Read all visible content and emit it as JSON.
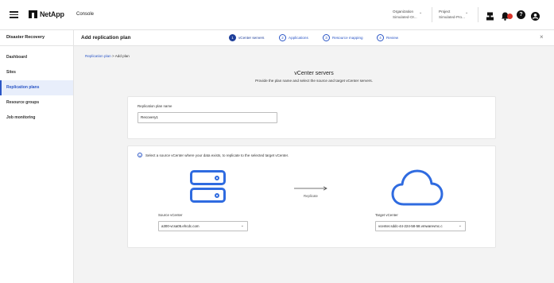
{
  "header": {
    "brand": "NetApp",
    "section": "Console",
    "organization": {
      "label": "Organization",
      "value": "Simulated-Or..."
    },
    "project": {
      "label": "Project",
      "value": "Simulated-Pro..."
    },
    "help_icon": "question-circle-icon",
    "user_icon": "user-circle-icon",
    "notifications_icon": "bell-icon",
    "connector_icon": "connector-icon",
    "badge_color": "#d9342b"
  },
  "subheader": {
    "service": "Disaster Recovery",
    "page_title": "Add replication plan",
    "steps": [
      {
        "num": "1",
        "label": "vCenter servers"
      },
      {
        "num": "2",
        "label": "Applications"
      },
      {
        "num": "3",
        "label": "Resource mapping"
      },
      {
        "num": "4",
        "label": "Review"
      }
    ],
    "active_step": 1,
    "close_label": "×"
  },
  "sidebar": {
    "items": [
      {
        "label": "Dashboard"
      },
      {
        "label": "Sites"
      },
      {
        "label": "Replication plans"
      },
      {
        "label": "Resource groups"
      },
      {
        "label": "Job monitoring"
      }
    ],
    "active_index": 2
  },
  "breadcrumb": {
    "link": "Replication plan",
    "separator": ">",
    "current": "Add plan"
  },
  "main": {
    "heading": "vCenter servers",
    "subheading": "Provide the plan name and select the source and target vCenter servers.",
    "plan_name": {
      "label": "Replication plan name",
      "value": "Recovery1"
    },
    "info_text": "Select a source vCenter where your data exists, to replicate to the selected target vCenter.",
    "replicate_label": "Replicate",
    "source": {
      "label": "Source vCenter",
      "value": "a300-vcsa05.ehcdc.com"
    },
    "target": {
      "label": "Target vCenter",
      "value": "vcenter.sddc-44-224-58-58.vmwarevmc.c"
    }
  },
  "colors": {
    "accent": "#2b56c6",
    "icon_blue": "#2f6be0"
  }
}
